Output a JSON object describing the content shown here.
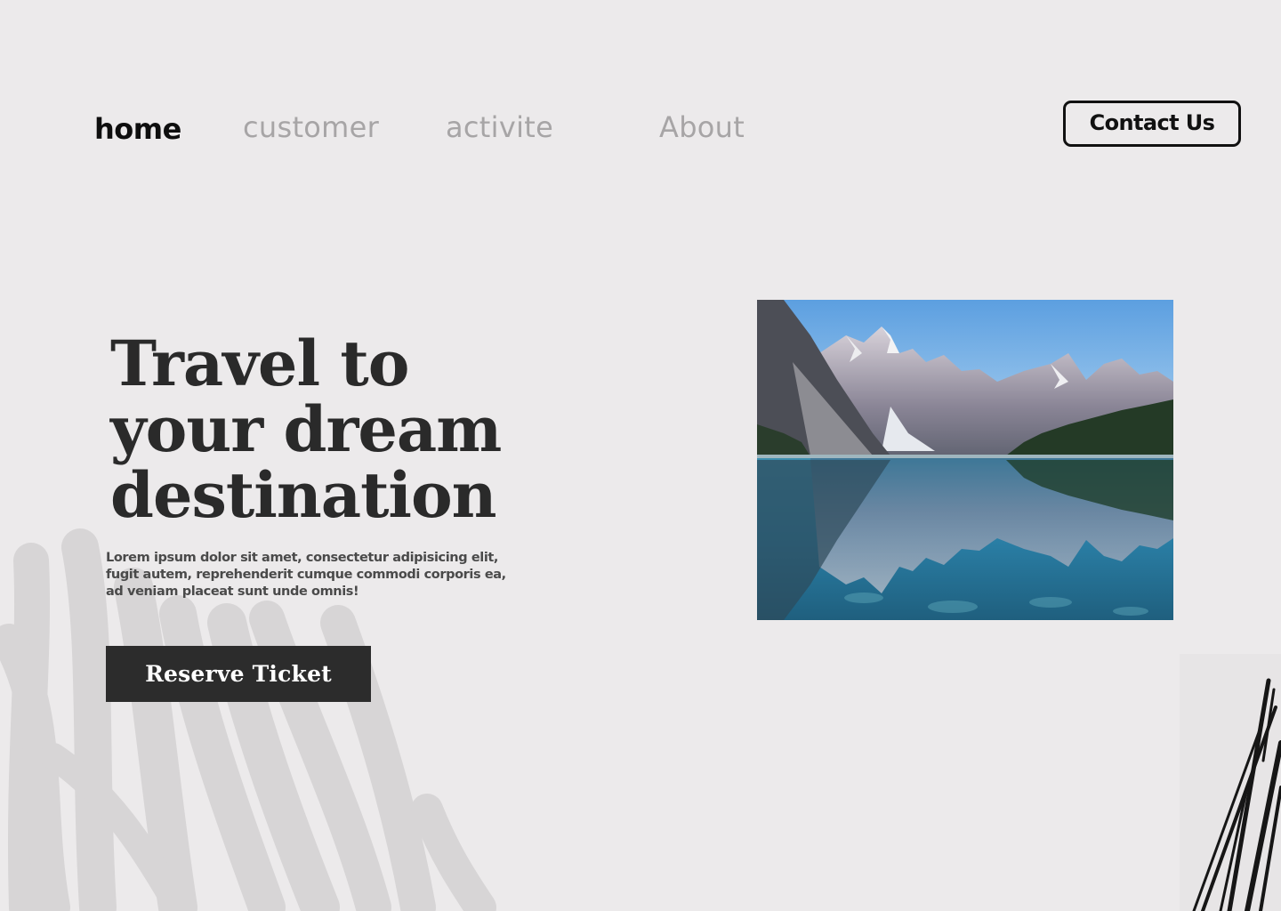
{
  "nav": {
    "items": [
      {
        "label": "home",
        "active": true
      },
      {
        "label": "customer",
        "active": false
      },
      {
        "label": "activite",
        "active": false
      },
      {
        "label": "About",
        "active": false
      }
    ],
    "contact_label": "Contact Us"
  },
  "hero": {
    "title_lines": [
      "Travel to",
      "your dream",
      "destination"
    ],
    "description": "Lorem ipsum dolor sit amet, consectetur adipisicing elit, fugit autem, reprehenderit cumque commodi corporis ea, ad veniam placeat sunt unde omnis!",
    "cta_label": "Reserve Ticket",
    "image_subject": "mountain-lake-photo"
  },
  "colors": {
    "background": "#ECEAEB",
    "text_dark": "#2A2A2A",
    "nav_inactive": "#A7A5A6",
    "button_bg": "#2C2C2C",
    "button_text": "#FFFFFF"
  },
  "decorations": {
    "left": "brush-stroke-decoration",
    "right": "scribble-decoration"
  }
}
